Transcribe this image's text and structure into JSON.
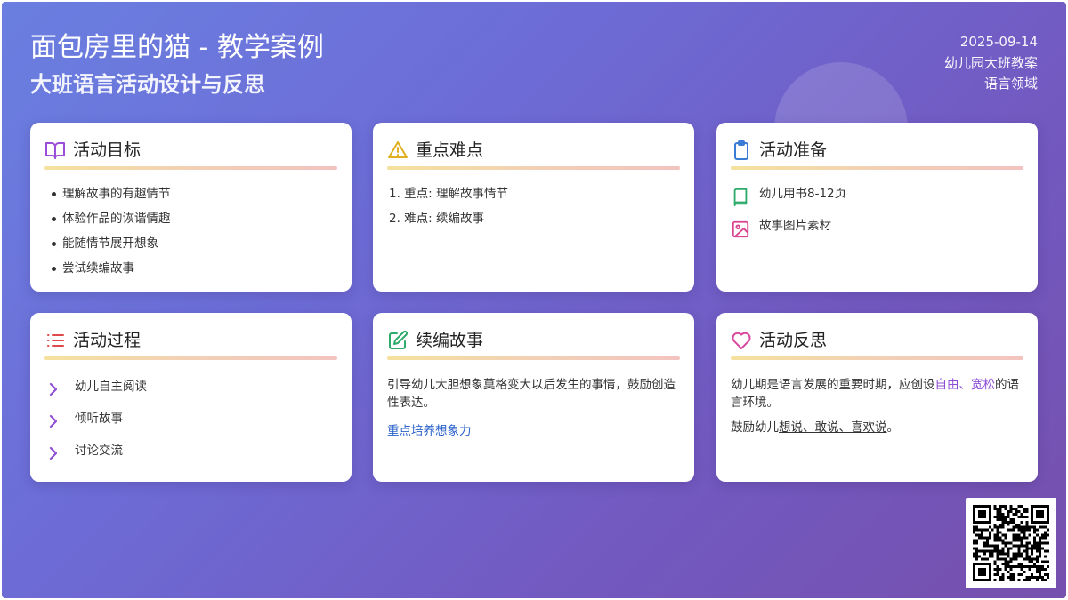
{
  "header": {
    "title": "面包房里的猫 - 教学案例",
    "subtitle": "大班语言活动设计与反思",
    "date": "2025-09-14",
    "type": "幼儿园大班教案",
    "domain": "语言领域"
  },
  "cards": {
    "goals": {
      "title": "活动目标",
      "icon": "book-open-icon",
      "items": [
        "理解故事的有趣情节",
        "体验作品的诙谐情趣",
        "能随情节展开想象",
        "尝试续编故事"
      ]
    },
    "keypoints": {
      "title": "重点难点",
      "icon": "warning-icon",
      "items": [
        "1. 重点: 理解故事情节",
        "2. 难点: 续编故事"
      ]
    },
    "prep": {
      "title": "活动准备",
      "icon": "clipboard-icon",
      "items": [
        {
          "icon": "book-icon",
          "text": "幼儿用书8-12页"
        },
        {
          "icon": "image-icon",
          "text": "故事图片素材"
        }
      ]
    },
    "process": {
      "title": "活动过程",
      "icon": "list-icon",
      "steps": [
        "幼儿自主阅读",
        "倾听故事",
        "讨论交流"
      ]
    },
    "sequel": {
      "title": "续编故事",
      "icon": "edit-icon",
      "text": "引导幼儿大胆想象莫格变大以后发生的事情，鼓励创造性表达。",
      "link": "重点培养想象力"
    },
    "reflection": {
      "title": "活动反思",
      "icon": "heart-icon",
      "p1_before": "幼儿期是语言发展的重要时期，应创设",
      "p1_accent": "自由、宽松",
      "p1_after": "的语言环境。",
      "p2_before": "鼓励幼儿",
      "p2_underline": "想说、敢说、喜欢说",
      "p2_after": "。"
    }
  },
  "colors": {
    "goals_icon": "#9b4fd8",
    "warning_icon": "#e0b020",
    "clipboard_icon": "#3a7bd5",
    "book_icon": "#2eaa6a",
    "image_icon": "#d9428f",
    "list_icon": "#e04a4a",
    "edit_icon": "#2eaa6a",
    "heart_icon": "#d9489f",
    "chevron": "#8f4ed6"
  }
}
